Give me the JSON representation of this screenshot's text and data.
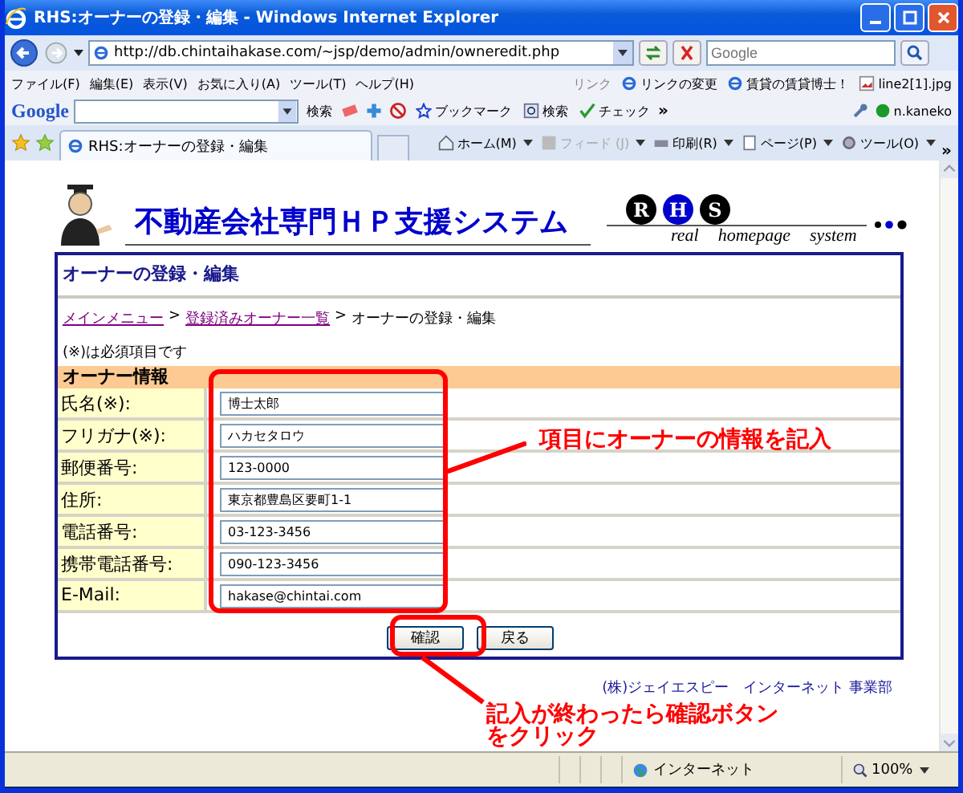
{
  "window": {
    "title": "RHS:オーナーの登録・編集 - Windows Internet Explorer"
  },
  "address_bar": {
    "url": "http://db.chintaihakase.com/~jsp/demo/admin/owneredit.php"
  },
  "search": {
    "placeholder": "Google"
  },
  "menu": [
    "ファイル(F)",
    "編集(E)",
    "表示(V)",
    "お気に入り(A)",
    "ツール(T)",
    "ヘルプ(H)"
  ],
  "links": {
    "label": "リンク",
    "items": [
      {
        "label": "リンクの変更",
        "kind": "page"
      },
      {
        "label": "賃貸の賃貸博士！",
        "kind": "page"
      },
      {
        "label": "line2[1].jpg",
        "kind": "image"
      }
    ]
  },
  "google_toolbar": {
    "logo": "Google",
    "search_button": "検索",
    "bookmarks": "ブックマーク",
    "search": "検索",
    "check": "チェック",
    "more": "»",
    "user": "n.kaneko"
  },
  "tab": {
    "title": "RHS:オーナーの登録・編集"
  },
  "commands": [
    {
      "label": "ホーム(M)",
      "kind": "home",
      "disabled": false
    },
    {
      "label": "フィード (J)",
      "kind": "feed",
      "disabled": true
    },
    {
      "label": "印刷(R)",
      "kind": "print",
      "disabled": false
    },
    {
      "label": "ページ(P)",
      "kind": "page",
      "disabled": false
    },
    {
      "label": "ツール(O)",
      "kind": "tools",
      "disabled": false
    }
  ],
  "commands_more": "»",
  "page": {
    "logo_title": "不動産会社専門ＨＰ支援システム",
    "badges": [
      {
        "letter": "R",
        "color": "#000000"
      },
      {
        "letter": "H",
        "color": "#0000cc"
      },
      {
        "letter": "S",
        "color": "#000000"
      }
    ],
    "tagline": [
      "real",
      "homepage",
      "system"
    ],
    "panel": {
      "title": "オーナーの登録・編集",
      "breadcrumb": [
        {
          "label": "メインメニュー",
          "kind": "link"
        },
        {
          "label": ">",
          "kind": "separator"
        },
        {
          "label": "登録済みオーナー一覧",
          "kind": "link"
        },
        {
          "label": ">",
          "kind": "separator"
        },
        {
          "label": "オーナーの登録・編集",
          "kind": "current"
        }
      ],
      "note": "(※)は必須項目です",
      "section": "オーナー情報",
      "fields": [
        {
          "label": "氏名(※):",
          "value": "博士太郎"
        },
        {
          "label": "フリガナ(※):",
          "value": "ハカセタロウ"
        },
        {
          "label": "郵便番号:",
          "value": "123-0000"
        },
        {
          "label": "住所:",
          "value": "東京都豊島区要町1-1"
        },
        {
          "label": "電話番号:",
          "value": "03-123-3456"
        },
        {
          "label": "携帯電話番号:",
          "value": "090-123-3456"
        },
        {
          "label": "E-Mail:",
          "value": "hakase@chintai.com"
        }
      ],
      "buttons": [
        "確認",
        "戻る"
      ]
    },
    "footer": "(株)ジェイエスピー　インターネット 事業部"
  },
  "annotations": [
    "項目にオーナーの情報を記入",
    "記入が終わったら確認ボタンをクリック"
  ],
  "status_bar": {
    "zone": "インターネット",
    "zoom": "100%"
  }
}
